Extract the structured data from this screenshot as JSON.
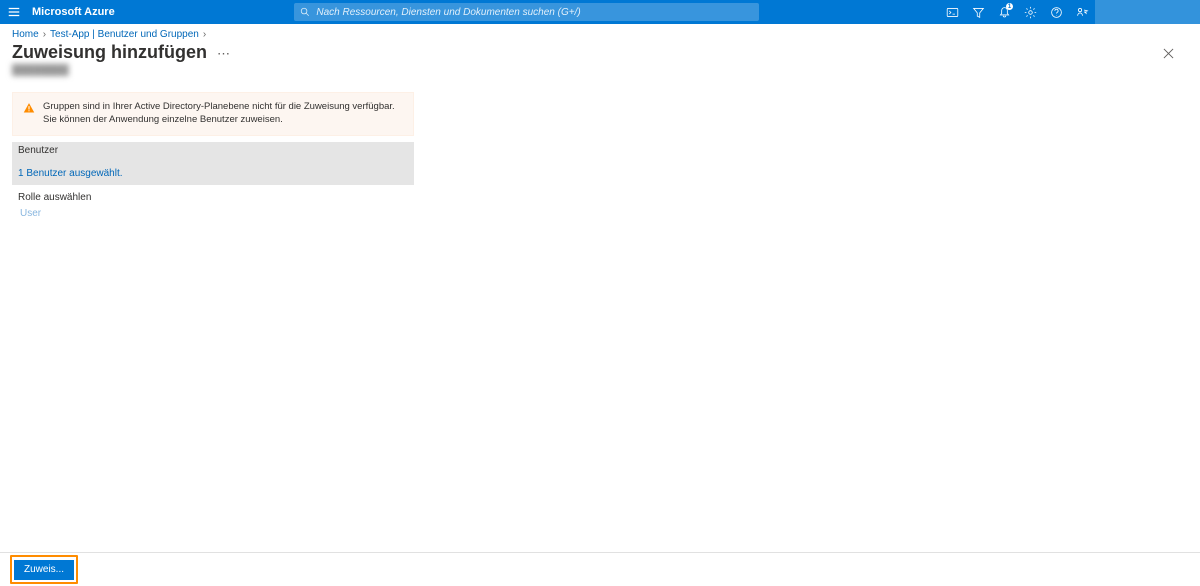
{
  "topbar": {
    "brand": "Microsoft Azure",
    "search_placeholder": "Nach Ressourcen, Diensten und Dokumenten suchen (G+/)",
    "notification_badge": "1"
  },
  "breadcrumb": {
    "items": [
      "Home",
      "Test-App | Benutzer und Gruppen"
    ]
  },
  "page": {
    "title": "Zuweisung hinzufügen",
    "subtitle": "████████"
  },
  "warning": {
    "text": "Gruppen sind in Ihrer Active Directory-Planebene nicht für die Zuweisung verfügbar. Sie können der Anwendung einzelne Benutzer zuweisen."
  },
  "users": {
    "header": "Benutzer",
    "selected_text": "1 Benutzer ausgewählt."
  },
  "role": {
    "header": "Rolle auswählen",
    "value": "User"
  },
  "footer": {
    "assign_label": "Zuweis..."
  }
}
